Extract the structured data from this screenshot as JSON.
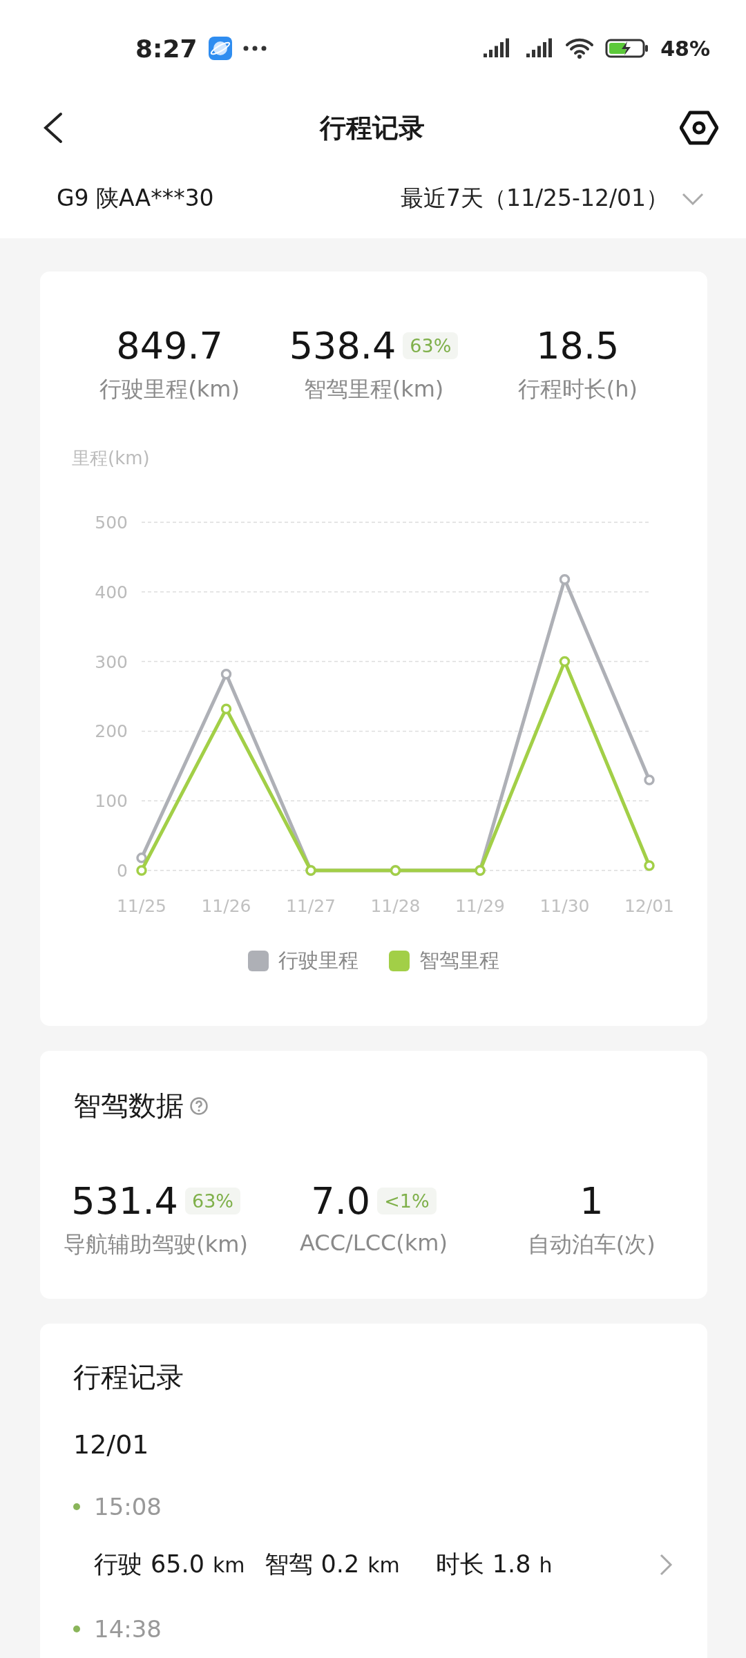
{
  "status_bar": {
    "time": "8:27",
    "battery": "48%"
  },
  "header": {
    "title": "行程记录"
  },
  "filter": {
    "vehicle": "G9 陕AA***30",
    "range": "最近7天（11/25-12/01）"
  },
  "summary": [
    {
      "value": "849.7",
      "label": "行驶里程(km)"
    },
    {
      "value": "538.4",
      "badge": "63%",
      "label": "智驾里程(km)"
    },
    {
      "value": "18.5",
      "label": "行程时长(h)"
    }
  ],
  "chart": {
    "chart_data": {
      "type": "line",
      "ylabel": "里程(km)",
      "grid": true,
      "legend": "bottom",
      "categories": [
        "11/25",
        "11/26",
        "11/27",
        "11/28",
        "11/29",
        "11/30",
        "12/01"
      ],
      "ylim": [
        0,
        500
      ],
      "yticks": [
        0,
        100,
        200,
        300,
        400,
        500
      ],
      "series": [
        {
          "name": "行驶里程",
          "color": "#aeb0b6",
          "marker": "circle",
          "values": [
            18,
            282,
            0,
            0,
            0,
            418,
            130
          ]
        },
        {
          "name": "智驾里程",
          "color": "#a2cf47",
          "marker": "circle",
          "values": [
            0,
            232,
            0,
            0,
            0,
            300,
            7
          ]
        }
      ]
    }
  },
  "smart_driving": {
    "title": "智驾数据",
    "items": [
      {
        "value": "531.4",
        "badge": "63%",
        "label": "导航辅助驾驶(km)"
      },
      {
        "value": "7.0",
        "badge": "<1%",
        "label": "ACC/LCC(km)"
      },
      {
        "value": "1",
        "label": "自动泊车(次)"
      }
    ]
  },
  "trips": {
    "title": "行程记录",
    "groups": [
      {
        "date": "12/01",
        "trips": [
          {
            "time": "15:08",
            "stats": [
              {
                "label": "行驶",
                "value": "65.0",
                "unit": "km"
              },
              {
                "label": "智驾",
                "value": "0.2",
                "unit": "km"
              },
              {
                "label": "时长",
                "value": "1.8",
                "unit": "h"
              }
            ]
          },
          {
            "time": "14:38"
          }
        ]
      }
    ]
  }
}
